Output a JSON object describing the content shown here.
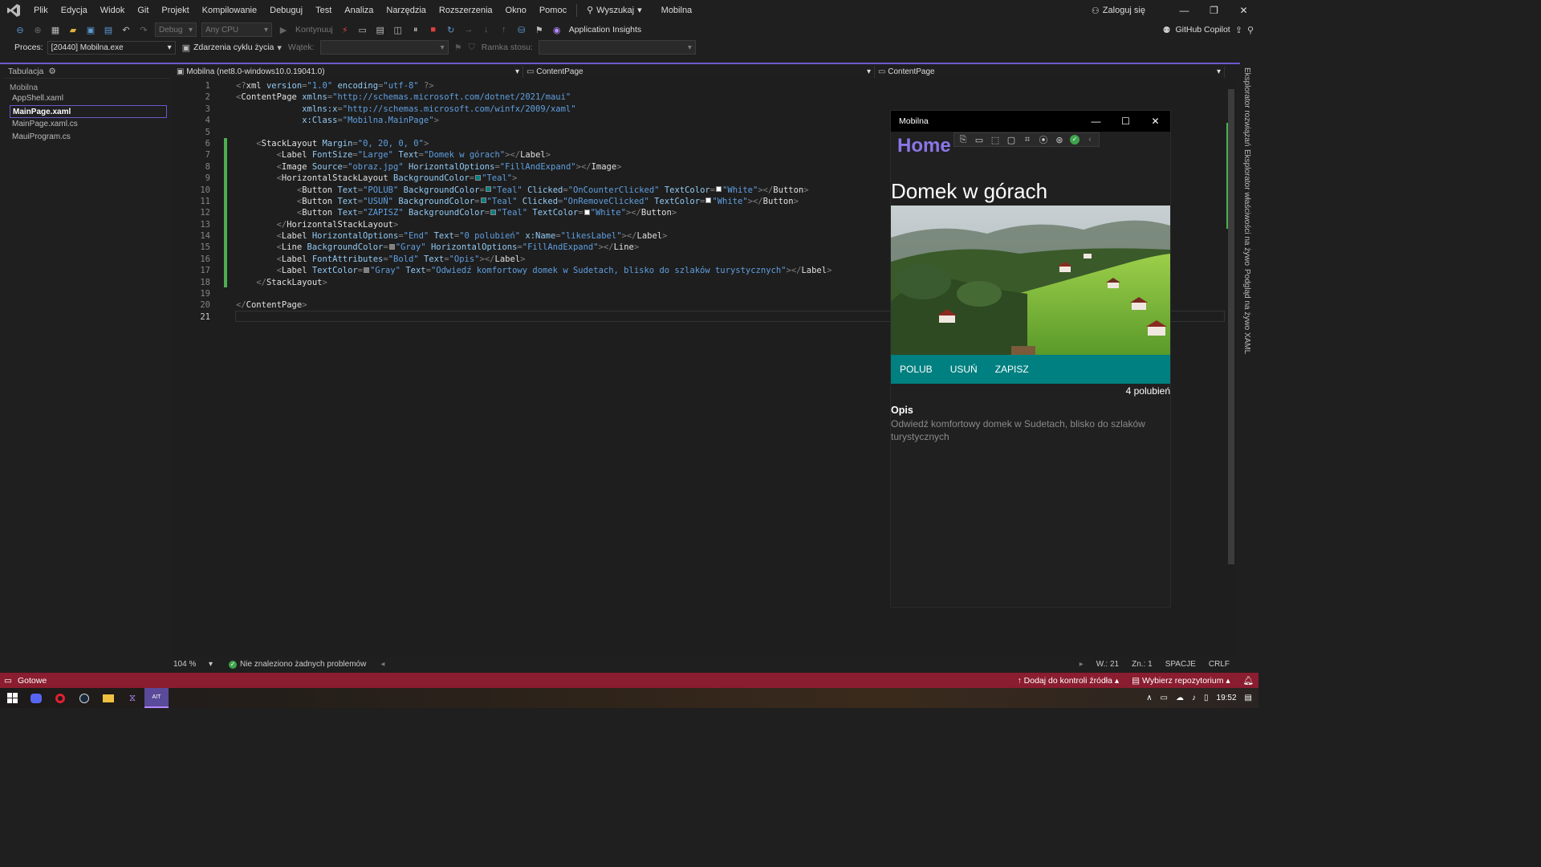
{
  "menubar": {
    "items": [
      "Plik",
      "Edycja",
      "Widok",
      "Git",
      "Projekt",
      "Kompilowanie",
      "Debuguj",
      "Test",
      "Analiza",
      "Narzędzia",
      "Rozszerzenia",
      "Okno",
      "Pomoc"
    ],
    "search_label": "Wyszukaj",
    "app_name": "Mobilna",
    "signin_label": "Zaloguj się"
  },
  "toolbar1": {
    "config": "Debug",
    "platform": "Any CPU",
    "continue_label": "Kontynuuj",
    "insights_label": "Application Insights",
    "copilot_label": "GitHub Copilot"
  },
  "toolbar2": {
    "process_label": "Proces:",
    "process_value": "[20440] Mobilna.exe",
    "lifecycle_label": "Zdarzenia cyklu życia",
    "thread_label": "Wątek:",
    "stackframe_label": "Ramka stosu:"
  },
  "left_panel": {
    "title": "Tabulacja",
    "group": "Mobilna",
    "files": [
      "AppShell.xaml",
      "MainPage.xaml",
      "MainPage.xaml.cs",
      "MauiProgram.cs"
    ],
    "active_file": "MainPage.xaml"
  },
  "editor": {
    "target_combo": "Mobilna (net8.0-windows10.0.19041.0)",
    "scope_combo_1": "ContentPage",
    "scope_combo_2": "ContentPage",
    "line_numbers": [
      "1",
      "2",
      "3",
      "4",
      "5",
      "6",
      "7",
      "8",
      "9",
      "10",
      "11",
      "12",
      "13",
      "14",
      "15",
      "16",
      "17",
      "18",
      "19",
      "20",
      "21"
    ],
    "lines": [
      "<?xml version=\"1.0\" encoding=\"utf-8\" ?>",
      "<ContentPage xmlns=\"http://schemas.microsoft.com/dotnet/2021/maui\"",
      "             xmlns:x=\"http://schemas.microsoft.com/winfx/2009/xaml\"",
      "             x:Class=\"Mobilna.MainPage\">",
      "",
      "    <StackLayout Margin=\"0, 20, 0, 0\">",
      "        <Label FontSize=\"Large\" Text=\"Domek w górach\"></Label>",
      "        <Image Source=\"obraz.jpg\" HorizontalOptions=\"FillAndExpand\"></Image>",
      "        <HorizontalStackLayout BackgroundColor=\"Teal\">",
      "            <Button Text=\"POLUB\" BackgroundColor=\"Teal\" Clicked=\"OnCounterClicked\" TextColor=\"White\"></Button>",
      "            <Button Text=\"USUŃ\" BackgroundColor=\"Teal\" Clicked=\"OnRemoveClicked\" TextColor=\"White\"></Button>",
      "            <Button Text=\"ZAPISZ\" BackgroundColor=\"Teal\" TextColor=\"White\"></Button>",
      "        </HorizontalStackLayout>",
      "        <Label HorizontalOptions=\"End\" Text=\"0 polubień\" x:Name=\"likesLabel\"></Label>",
      "        <Line BackgroundColor=\"Gray\" HorizontalOptions=\"FillAndExpand\"></Line>",
      "        <Label FontAttributes=\"Bold\" Text=\"Opis\"></Label>",
      "        <Label TextColor=\"Gray\" Text=\"Odwiedź komfortowy domek w Sudetach, blisko do szlaków turystycznych\"></Label>",
      "    </StackLayout>",
      "",
      "</ContentPage>",
      ""
    ],
    "zoom": "104 %",
    "problems_label": "Nie znaleziono żadnych problemów",
    "position_line": "W.: 21",
    "position_col": "Zn.: 1",
    "indent_mode": "SPACJE",
    "line_ending": "CRLF"
  },
  "right_tabs": [
    "Eksplorator rozwiązań",
    "Eksplorator właściwości na żywo",
    "Podgląd na żywo XAML"
  ],
  "preview": {
    "window_title": "Mobilna",
    "nav_title": "Home",
    "heading": "Domek w górach",
    "buttons": [
      "POLUB",
      "USUŃ",
      "ZAPISZ"
    ],
    "likes": "4 polubień",
    "opis": "Opis",
    "description": "Odwiedź komfortowy domek w Sudetach, blisko do szlaków turystycznych"
  },
  "statusbar": {
    "ready": "Gotowe",
    "source_control": "Dodaj do kontroli źródła",
    "repo": "Wybierz repozytorium"
  },
  "taskbar": {
    "time": "19:52"
  },
  "colors": {
    "accent": "#6a5acd",
    "status_bg": "#8a1d2f",
    "teal": "#008080",
    "home_purple": "#8b76e8"
  }
}
